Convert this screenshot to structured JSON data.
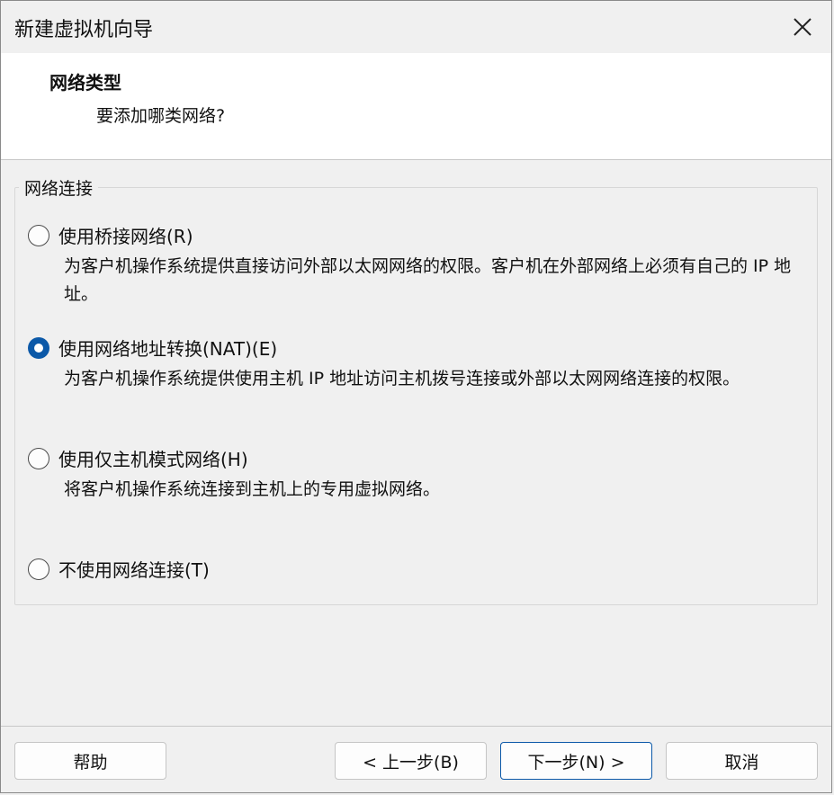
{
  "window": {
    "title": "新建虚拟机向导"
  },
  "header": {
    "title": "网络类型",
    "subtitle": "要添加哪类网络?"
  },
  "group": {
    "label": "网络连接"
  },
  "options": [
    {
      "label": "使用桥接网络(R)",
      "description": "为客户机操作系统提供直接访问外部以太网网络的权限。客户机在外部网络上必须有自己的 IP 地址。",
      "checked": false
    },
    {
      "label": "使用网络地址转换(NAT)(E)",
      "description": "为客户机操作系统提供使用主机 IP 地址访问主机拨号连接或外部以太网网络连接的权限。",
      "checked": true
    },
    {
      "label": "使用仅主机模式网络(H)",
      "description": "将客户机操作系统连接到主机上的专用虚拟网络。",
      "checked": false
    },
    {
      "label": "不使用网络连接(T)",
      "description": "",
      "checked": false
    }
  ],
  "buttons": {
    "help": "帮助",
    "back": "< 上一步(B)",
    "next": "下一步(N) >",
    "cancel": "取消"
  },
  "colors": {
    "accent": "#0c59a8",
    "header_bg": "#ffffff",
    "window_bg": "#f0f0f0"
  },
  "icons": {
    "close": "close-icon"
  }
}
